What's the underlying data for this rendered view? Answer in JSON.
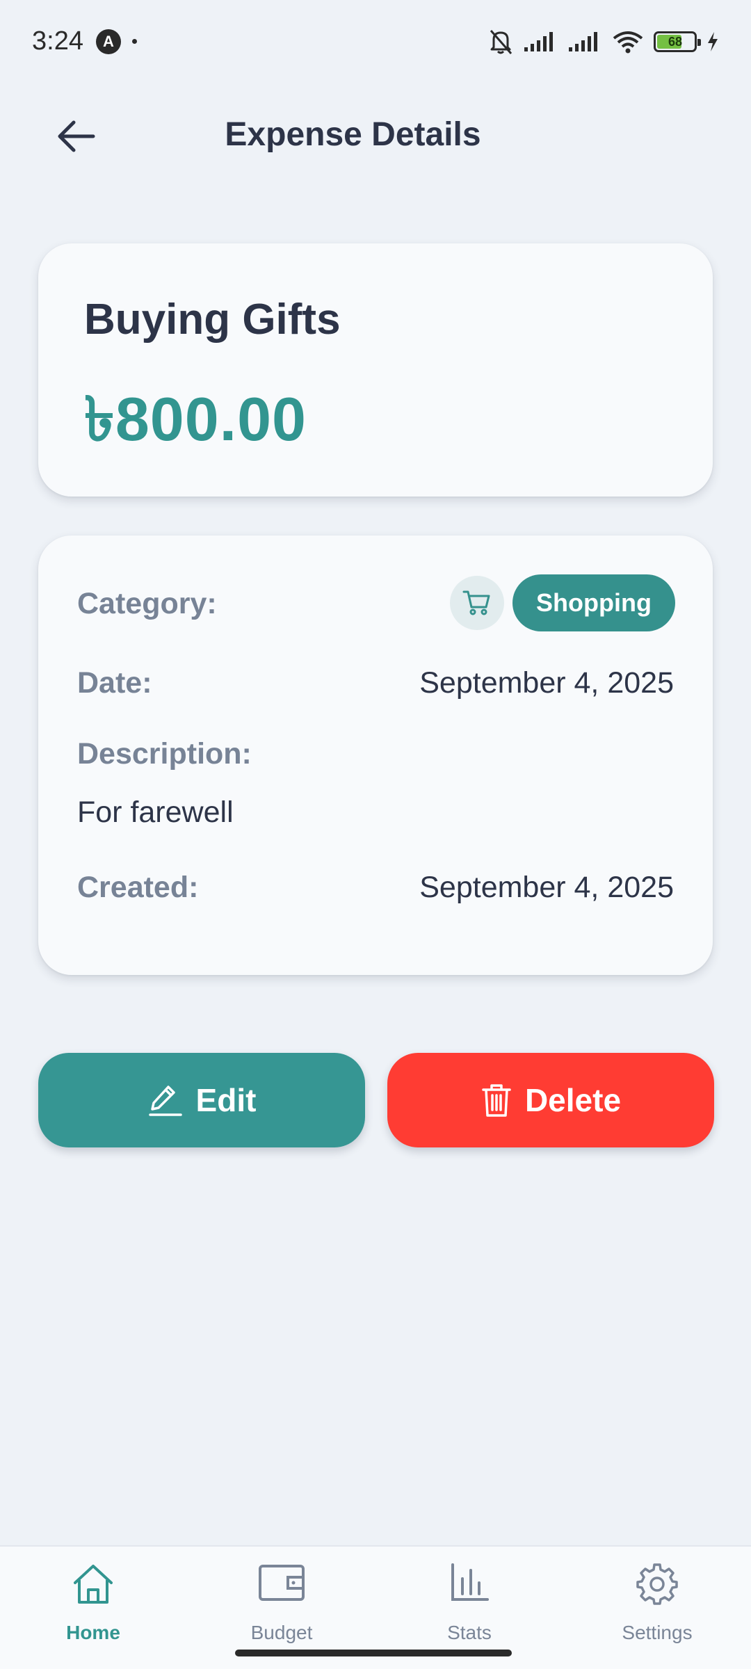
{
  "status_bar": {
    "time": "3:24",
    "app_icon_letter": "A",
    "battery_level": "68",
    "icons": [
      "bell-off-icon",
      "signal-icon",
      "signal-icon",
      "wifi-icon",
      "battery-icon",
      "charging-icon"
    ]
  },
  "header": {
    "title": "Expense Details",
    "back_icon": "arrow-left-icon"
  },
  "expense": {
    "title": "Buying Gifts",
    "amount": "৳800.00"
  },
  "details": {
    "category_label": "Category:",
    "category_value": "Shopping",
    "category_icon": "shopping-cart-icon",
    "date_label": "Date:",
    "date_value": "September 4, 2025",
    "description_label": "Description:",
    "description_value": "For farewell",
    "created_label": "Created:",
    "created_value": "September 4, 2025"
  },
  "actions": {
    "edit_label": "Edit",
    "delete_label": "Delete"
  },
  "bottom_nav": {
    "items": [
      {
        "label": "Home",
        "icon": "home-icon",
        "active": true
      },
      {
        "label": "Budget",
        "icon": "wallet-icon",
        "active": false
      },
      {
        "label": "Stats",
        "icon": "bar-chart-icon",
        "active": false
      },
      {
        "label": "Settings",
        "icon": "gear-icon",
        "active": false
      }
    ]
  },
  "colors": {
    "accent": "#329590",
    "danger": "#ff3c33",
    "background": "#eef2f7",
    "card": "#f8fafc",
    "label": "#778396",
    "text": "#2d3448"
  }
}
